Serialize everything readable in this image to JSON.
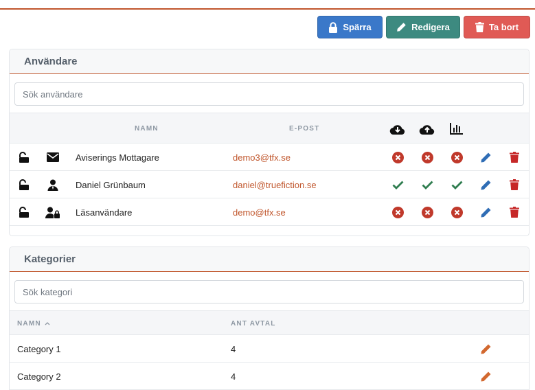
{
  "toolbar": {
    "lock_label": "Spärra",
    "edit_label": "Redigera",
    "delete_label": "Ta bort"
  },
  "users": {
    "title": "Användare",
    "search_placeholder": "Sök användare",
    "columns": {
      "name": "NAMN",
      "email": "E-POST"
    },
    "column_icons": [
      "download-cloud-icon",
      "upload-cloud-icon",
      "bar-chart-icon"
    ],
    "rows": [
      {
        "name": "Aviserings Mottagare",
        "email": "demo3@tfx.se",
        "type_icon": "envelope-icon",
        "download": false,
        "upload": false,
        "stats": false
      },
      {
        "name": "Daniel Grünbaum",
        "email": "daniel@truefiction.se",
        "type_icon": "user-icon",
        "download": true,
        "upload": true,
        "stats": true
      },
      {
        "name": "Läsanvändare",
        "email": "demo@tfx.se",
        "type_icon": "user-lock-icon",
        "download": false,
        "upload": false,
        "stats": false
      }
    ]
  },
  "categories": {
    "title": "Kategorier",
    "search_placeholder": "Sök kategori",
    "columns": {
      "name": "NAMN",
      "count": "ANT AVTAL"
    },
    "rows": [
      {
        "name": "Category 1",
        "count": "4"
      },
      {
        "name": "Category 2",
        "count": "4"
      }
    ]
  },
  "colors": {
    "accent": "#c0552b",
    "primary": "#3a78c9",
    "teal": "#3d8a80",
    "danger": "#e05a55",
    "success": "#2f7d4f",
    "error": "#c0392b",
    "delete": "#c62828",
    "edit_blue": "#2f6db5",
    "edit_orange": "#d2682f"
  }
}
